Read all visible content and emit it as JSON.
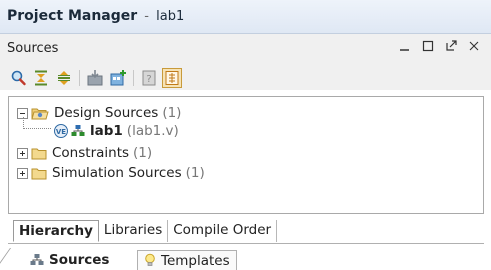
{
  "window": {
    "title": "Project Manager",
    "separator": "-",
    "project": "lab1"
  },
  "panel": {
    "title": "Sources",
    "controls": [
      "minimize-icon",
      "maximize-icon",
      "undock-icon",
      "close-icon"
    ]
  },
  "toolbar": {
    "icons": [
      "search-icon",
      "collapse-all-icon",
      "expand-all-icon",
      "import-icon",
      "add-sources-icon",
      "properties-icon",
      "show-hierarchy-icon"
    ]
  },
  "tree": {
    "design_sources": {
      "label": "Design Sources",
      "count": "(1)"
    },
    "lab1": {
      "label": "lab1",
      "file": "(lab1.v)"
    },
    "constraints": {
      "label": "Constraints",
      "count": "(1)"
    },
    "simulation_sources": {
      "label": "Simulation Sources",
      "count": "(1)"
    }
  },
  "view_tabs": [
    "Hierarchy",
    "Libraries",
    "Compile Order"
  ],
  "bottom_tabs": {
    "sources": "Sources",
    "templates": "Templates"
  },
  "colors": {
    "title_bg": "#dfe8f4",
    "panel_bg": "#f0f0f0",
    "pressed_bg": "#f6e3b6",
    "folder": "#e8c36a"
  }
}
